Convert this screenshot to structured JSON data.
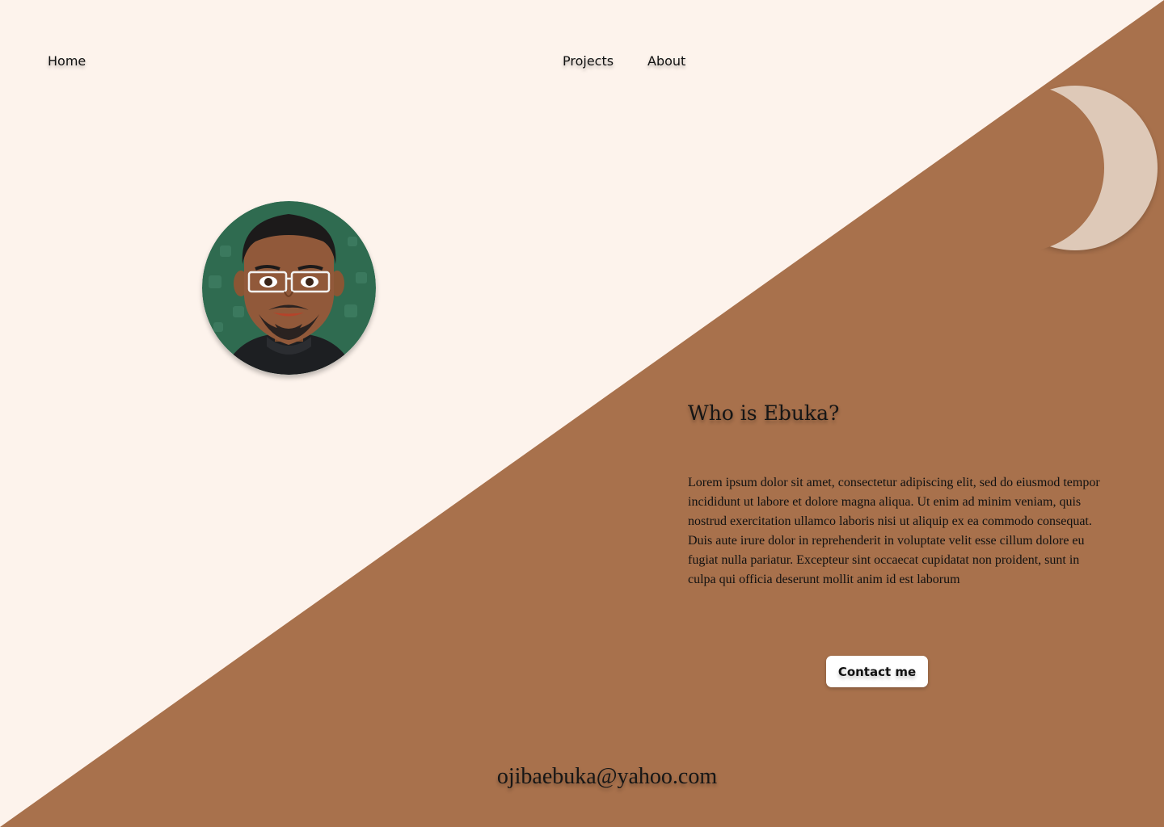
{
  "colors": {
    "background_light": "#fdf3ec",
    "background_brown": "#a8714c",
    "moon": "#dec9b8",
    "button_bg": "#ffffff",
    "text": "#111111"
  },
  "nav": {
    "home": "Home",
    "projects": "Projects",
    "about": "About"
  },
  "hero": {
    "avatar_icon": "bitmoji-avatar-icon",
    "moon_icon": "crescent-moon-icon"
  },
  "about": {
    "title": "Who is Ebuka?",
    "body": "Lorem ipsum dolor sit amet, consectetur adipiscing elit, sed do eiusmod tempor incididunt ut labore et dolore magna aliqua. Ut enim ad minim veniam, quis nostrud exercitation ullamco laboris nisi ut aliquip ex ea commodo consequat. Duis aute irure dolor in reprehenderit in voluptate velit esse cillum dolore eu fugiat nulla pariatur. Excepteur sint occaecat cupidatat non proident, sunt in culpa qui officia deserunt mollit anim id est laborum",
    "contact_button": "Contact me"
  },
  "footer": {
    "email": "ojibaebuka@yahoo.com"
  }
}
